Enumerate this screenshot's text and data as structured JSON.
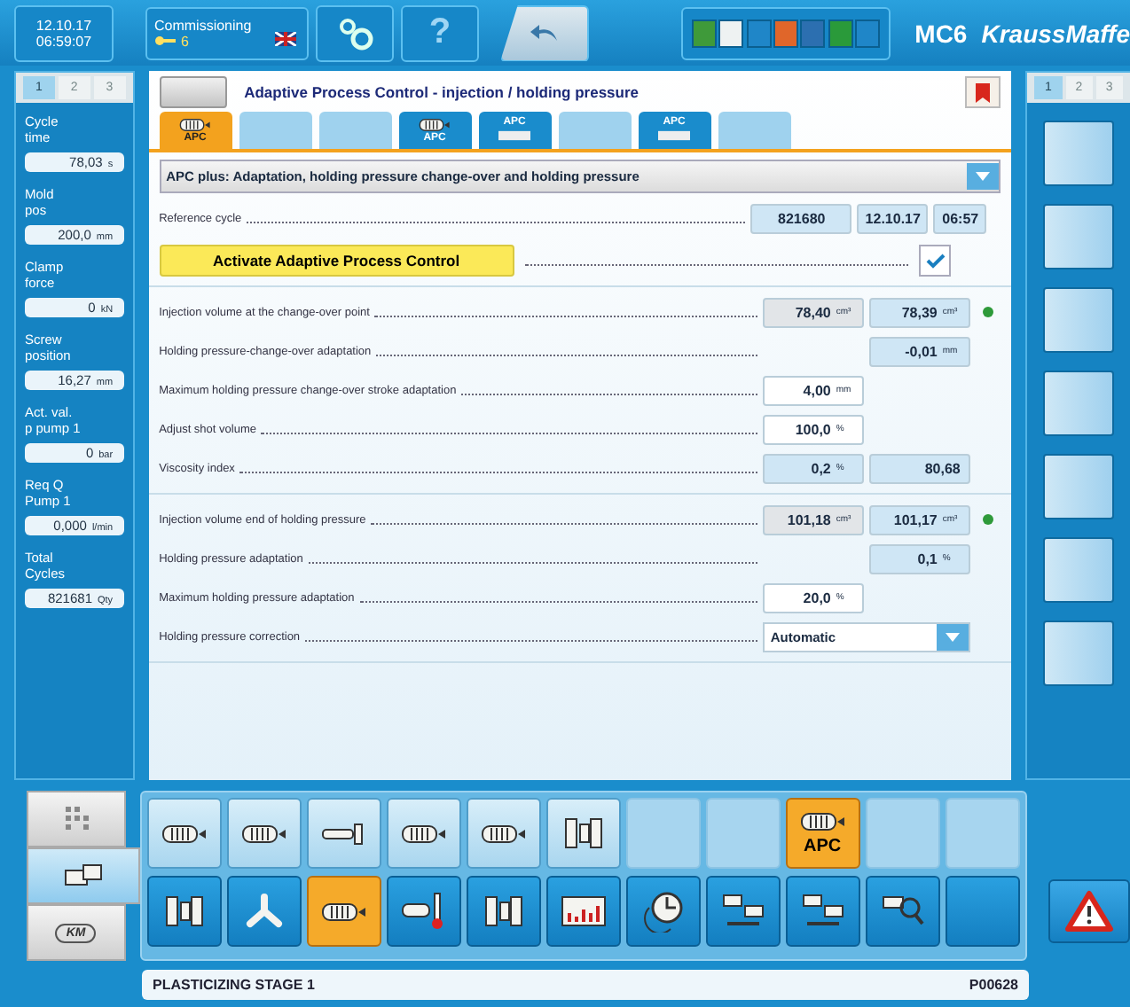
{
  "header": {
    "date": "12.10.17",
    "time": "06:59:07",
    "mode": "Commissioning",
    "access_level": "6",
    "help": "?",
    "status_tiles": [
      {
        "color": "#3f9a3a"
      },
      {
        "color": "#eef2f2"
      },
      {
        "color": "#1f86c8"
      },
      {
        "color": "#e0662a"
      },
      {
        "color": "#2c6fb0"
      },
      {
        "color": "#2a9a3a"
      },
      {
        "color": "#1f86c8"
      }
    ],
    "model": "MC6",
    "brand": "KraussMaffe"
  },
  "left_panel": {
    "tabs": [
      {
        "label": "1",
        "selected": true
      },
      {
        "label": "2",
        "selected": false
      },
      {
        "label": "3",
        "selected": false
      }
    ],
    "items": [
      {
        "label": "Cycle\ntime",
        "value": "78,03",
        "unit": "s"
      },
      {
        "label": "Mold\npos",
        "value": "200,0",
        "unit": "mm"
      },
      {
        "label": "Clamp\nforce",
        "value": "0",
        "unit": "kN"
      },
      {
        "label": "Screw\nposition",
        "value": "16,27",
        "unit": "mm"
      },
      {
        "label": "Act. val.\np pump 1",
        "value": "0",
        "unit": "bar"
      },
      {
        "label": "Req Q\nPump 1",
        "value": "0,000",
        "unit": "l/min"
      },
      {
        "label": "Total\nCycles",
        "value": "821681",
        "unit": "Qty"
      }
    ]
  },
  "page": {
    "title": "Adaptive Process Control - injection / holding pressure",
    "tabs": [
      {
        "kind": "screw",
        "label": "APC",
        "selected": true
      },
      {
        "kind": "blank",
        "selected": false
      },
      {
        "kind": "blank",
        "selected": false
      },
      {
        "kind": "screw",
        "label": "APC",
        "selected": false
      },
      {
        "kind": "apc",
        "label": "APC",
        "selected": false
      },
      {
        "kind": "blank",
        "selected": false
      },
      {
        "kind": "apc",
        "label": "APC",
        "selected": false
      },
      {
        "kind": "blank",
        "selected": false
      }
    ],
    "program": "APC plus: Adaptation, holding pressure change-over and holding pressure",
    "reference": {
      "label": "Reference cycle",
      "cycle": "821680",
      "date": "12.10.17",
      "time": "06:57"
    },
    "activate": {
      "label": "Activate Adaptive Process Control",
      "checked": true
    },
    "groups": [
      [
        {
          "label": "Injection volume at the change-over point",
          "fields": [
            {
              "kind": "actual",
              "value": "78,40",
              "unit": "cm³"
            },
            {
              "kind": "display",
              "value": "78,39",
              "unit": "cm³"
            }
          ],
          "color": "#2e9a3a"
        },
        {
          "label": "Holding pressure-change-over adaptation",
          "kind": "result",
          "fields": [
            {
              "kind": "display",
              "value": "-0,01",
              "unit": "mm"
            }
          ]
        },
        {
          "label": "Maximum holding pressure change-over stroke adaptation",
          "fields": [
            {
              "kind": "input",
              "value": "4,00",
              "unit": "mm"
            }
          ]
        },
        {
          "label": "Adjust shot volume",
          "fields": [
            {
              "kind": "input",
              "value": "100,0",
              "unit": "%"
            }
          ]
        },
        {
          "label": "Viscosity index",
          "fields": [
            {
              "kind": "display",
              "value": "0,2",
              "unit": "%"
            },
            {
              "kind": "display",
              "value": "80,68"
            }
          ]
        }
      ],
      [
        {
          "label": "Injection volume end of holding pressure",
          "fields": [
            {
              "kind": "actual",
              "value": "101,18",
              "unit": "cm³"
            },
            {
              "kind": "display",
              "value": "101,17",
              "unit": "cm³"
            }
          ],
          "color": "#2e9a3a"
        },
        {
          "label": "Holding pressure adaptation",
          "kind": "result",
          "fields": [
            {
              "kind": "display",
              "value": "0,1",
              "unit": "%"
            }
          ]
        },
        {
          "label": "Maximum holding pressure adaptation",
          "fields": [
            {
              "kind": "input",
              "value": "20,0",
              "unit": "%"
            }
          ]
        },
        {
          "label": "Holding pressure correction",
          "fields": [
            {
              "kind": "select",
              "value": "Automatic"
            }
          ]
        }
      ]
    ]
  },
  "right_panel": {
    "tabs": [
      {
        "label": "1",
        "selected": true
      },
      {
        "label": "2",
        "selected": false
      },
      {
        "label": "3",
        "selected": false
      }
    ],
    "buttons": [
      {
        "kind": "blank"
      },
      {
        "kind": "blank"
      },
      {
        "kind": "blank"
      },
      {
        "kind": "blank"
      },
      {
        "kind": "blank"
      },
      {
        "kind": "blank"
      },
      {
        "kind": "blank"
      }
    ]
  },
  "nav": [
    {
      "kind": "grid",
      "selected": false
    },
    {
      "kind": "modules",
      "selected": true
    },
    {
      "kind": "logo",
      "label": "KM",
      "selected": false
    }
  ],
  "toolbar": [
    [
      {
        "kind": "screw",
        "selected": false
      },
      {
        "kind": "screw",
        "selected": false
      },
      {
        "kind": "nozzle",
        "selected": false
      },
      {
        "kind": "screw",
        "selected": false
      },
      {
        "kind": "screw",
        "selected": false
      },
      {
        "kind": "mold",
        "selected": false
      },
      {
        "kind": "blank",
        "selected": false
      },
      {
        "kind": "blank",
        "selected": false
      },
      {
        "kind": "screw",
        "label": "APC",
        "selected": true
      },
      {
        "kind": "blank",
        "selected": false
      },
      {
        "kind": "blank",
        "selected": false
      }
    ],
    [
      {
        "kind": "mold",
        "selected": false
      },
      {
        "kind": "branch",
        "selected": false
      },
      {
        "kind": "screw",
        "selected": true
      },
      {
        "kind": "thermo",
        "selected": false
      },
      {
        "kind": "mold",
        "selected": false
      },
      {
        "kind": "chart",
        "selected": false
      },
      {
        "kind": "clock",
        "selected": false
      },
      {
        "kind": "network",
        "selected": false
      },
      {
        "kind": "network",
        "selected": false
      },
      {
        "kind": "search",
        "selected": false
      },
      {
        "kind": "blank",
        "selected": false
      }
    ]
  ],
  "status_bar": {
    "message": "PLASTICIZING STAGE 1",
    "code": "P00628"
  }
}
